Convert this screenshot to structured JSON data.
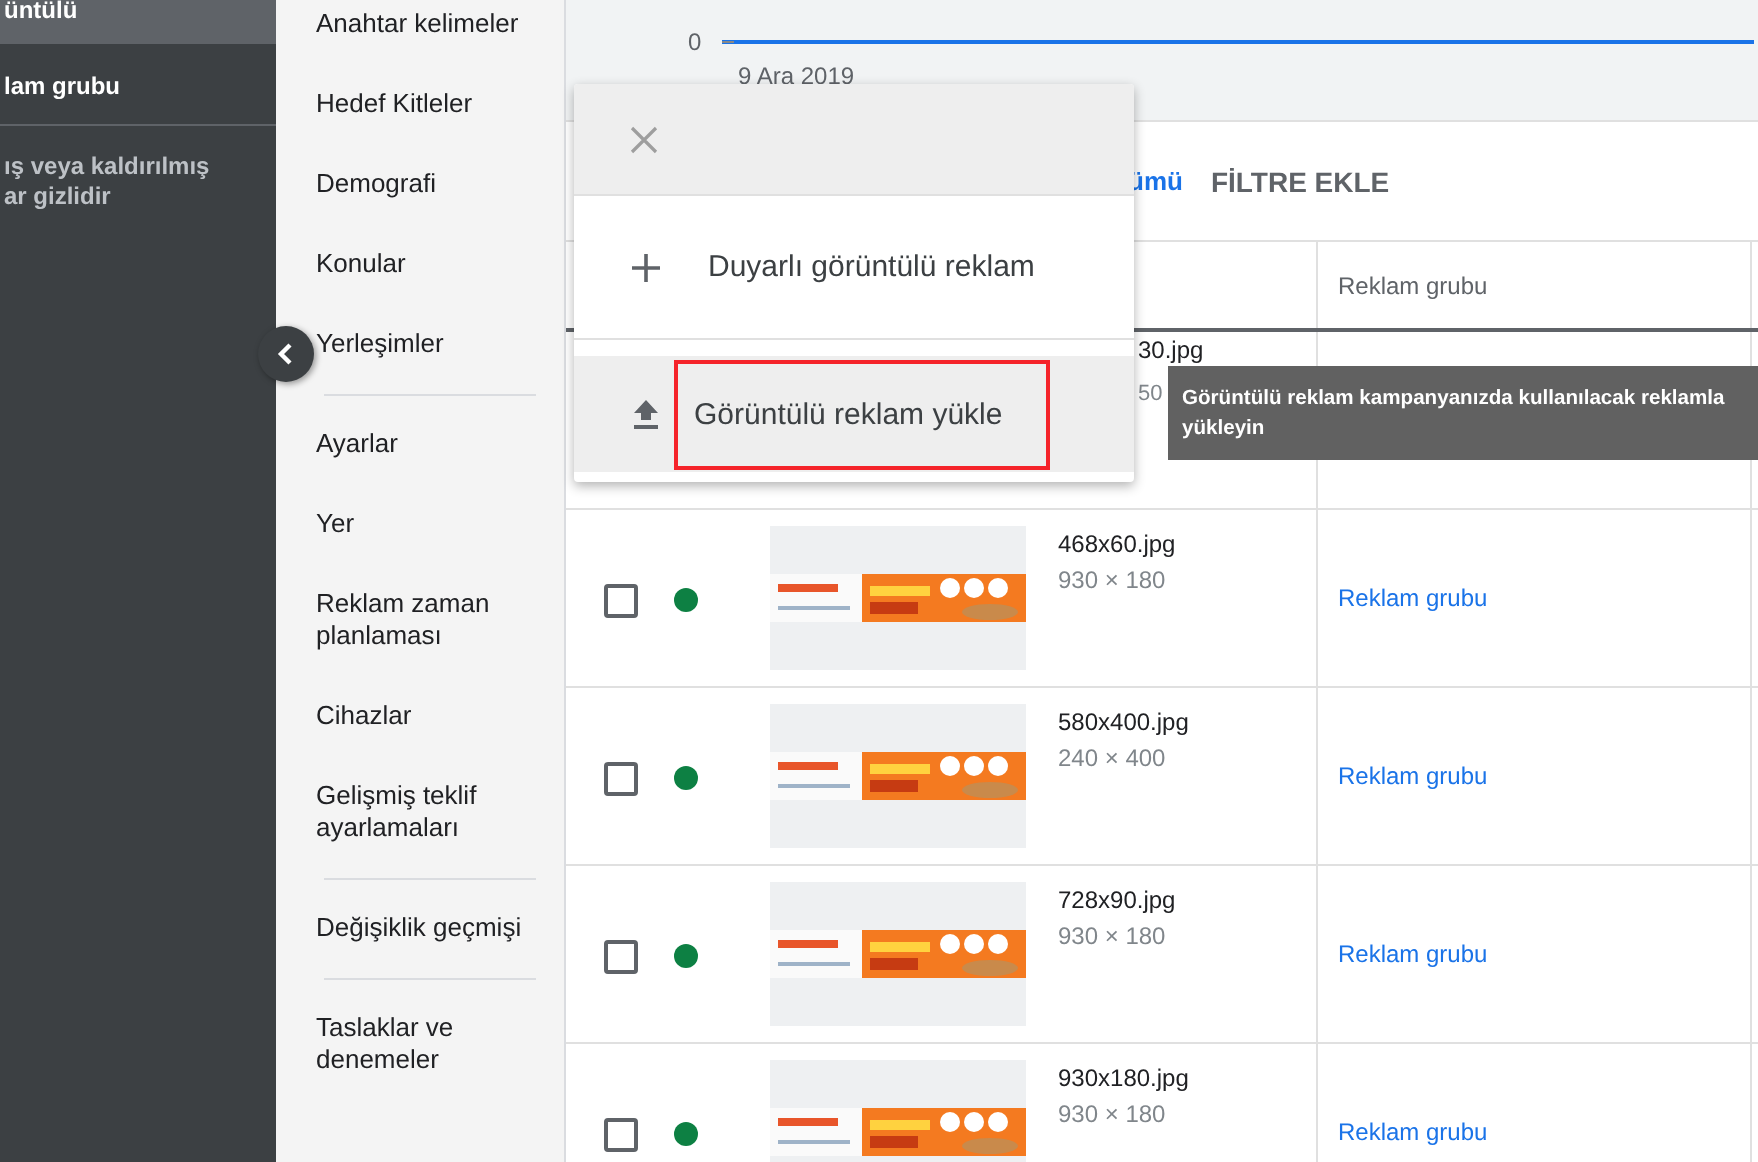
{
  "sidebar": {
    "items": [
      {
        "label": "üntülü",
        "selected": true
      },
      {
        "label": "lam grubu",
        "selected": false
      }
    ],
    "note_lines": [
      "ış veya kaldırılmış",
      "ar gizlidir"
    ]
  },
  "nav": {
    "items": [
      {
        "kind": "link",
        "label": "Anahtar kelimeler"
      },
      {
        "kind": "link",
        "label": "Hedef Kitleler"
      },
      {
        "kind": "link",
        "label": "Demografi"
      },
      {
        "kind": "link",
        "label": "Konular"
      },
      {
        "kind": "link",
        "label": "Yerleşimler"
      },
      {
        "kind": "divider"
      },
      {
        "kind": "link",
        "label": "Ayarlar"
      },
      {
        "kind": "link",
        "label": "Yer"
      },
      {
        "kind": "link",
        "label": "Reklam zaman planlaması"
      },
      {
        "kind": "link",
        "label": "Cihazlar"
      },
      {
        "kind": "link",
        "label": "Gelişmiş teklif ayarlamaları"
      },
      {
        "kind": "divider"
      },
      {
        "kind": "link",
        "label": "Değişiklik geçmişi"
      },
      {
        "kind": "divider"
      },
      {
        "kind": "link",
        "label": "Taslaklar ve denemeler"
      }
    ]
  },
  "chart": {
    "y_label": "0",
    "x_label": "9 Ara 2019"
  },
  "toolbar": {
    "link": "ümü",
    "filter_button": "FİLTRE EKLE"
  },
  "table": {
    "columns": [
      {
        "label": "Reklam grubu"
      }
    ],
    "rows": [
      {
        "kind": "partial",
        "name": "30.jpg",
        "size": "50"
      },
      {
        "kind": "full",
        "checked": false,
        "active": true,
        "name": "468x60.jpg",
        "size": "930 × 180",
        "ad_group": "Reklam grubu"
      },
      {
        "kind": "full",
        "checked": false,
        "active": true,
        "name": "580x400.jpg",
        "size": "240 × 400",
        "ad_group": "Reklam grubu"
      },
      {
        "kind": "full",
        "checked": false,
        "active": true,
        "name": "728x90.jpg",
        "size": "930 × 180",
        "ad_group": "Reklam grubu"
      },
      {
        "kind": "full",
        "checked": false,
        "active": true,
        "name": "930x180.jpg",
        "size": "930 × 180",
        "ad_group": "Reklam grubu"
      }
    ]
  },
  "menu": {
    "items": [
      {
        "kind": "add",
        "label": "Duyarlı görüntülü reklam",
        "hovered": false,
        "outlined": false
      },
      {
        "kind": "upload",
        "label": "Görüntülü reklam yükle",
        "hovered": true,
        "outlined": true
      }
    ]
  },
  "tooltip": {
    "lines": [
      "Görüntülü reklam kampanyanızda kullanılacak reklamla",
      "yükleyin"
    ]
  }
}
